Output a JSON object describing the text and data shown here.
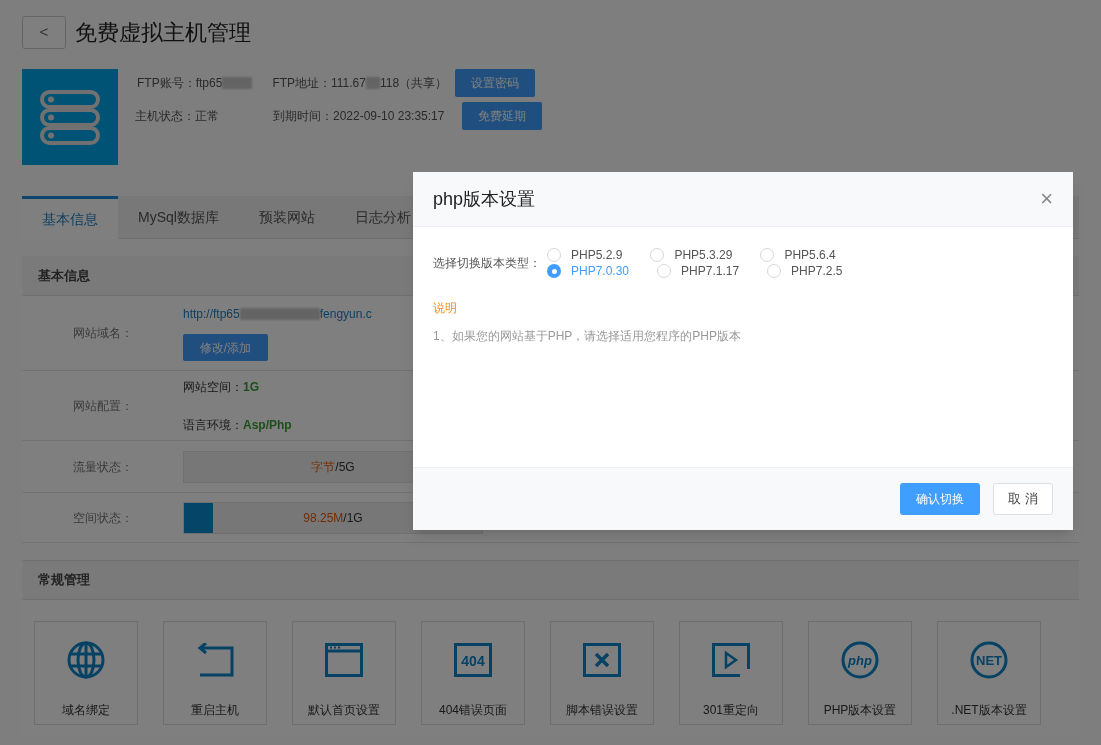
{
  "header": {
    "back": "<",
    "title": "免费虚拟主机管理"
  },
  "info": {
    "ftp_account_label": "FTP账号：",
    "ftp_account": "ftp65",
    "ftp_address_label": "FTP地址：",
    "ftp_address_start": "111.67",
    "ftp_address_end": "118（共享）",
    "set_password": "设置密码",
    "status_label": "主机状态：",
    "status": "正常",
    "expiry_label": "到期时间：",
    "expiry": "2022-09-10 23:35:17",
    "extend": "免费延期"
  },
  "tabs": [
    {
      "label": "基本信息",
      "selected": true
    },
    {
      "label": "MySql数据库",
      "selected": false
    },
    {
      "label": "预装网站",
      "selected": false
    },
    {
      "label": "日志分析",
      "selected": false
    }
  ],
  "basic": {
    "title": "基本信息",
    "domain_label": "网站域名：",
    "url_start": "http://ftp65",
    "url_end": "fengyun.c",
    "edit_button": "修改/添加",
    "config_label": "网站配置：",
    "space_label": "网站空间：",
    "space_value": "1G",
    "lang_label": "语言环境：",
    "lang_value": "Asp/Php",
    "traffic_label": "流量状态：",
    "traffic_used": "字节",
    "traffic_total": "/5G",
    "disk_label": "空间状态：",
    "disk_used": "98.25M",
    "disk_total": "/1G",
    "disk_bar": {
      "level": 0.097
    }
  },
  "management": {
    "title": "常规管理",
    "tiles": [
      {
        "kind": "globe",
        "label": "域名绑定"
      },
      {
        "kind": "return",
        "label": "重启主机"
      },
      {
        "kind": "window",
        "label": "默认首页设置"
      },
      {
        "kind": "boxtext",
        "icon_text": "404",
        "label": "404错误页面"
      },
      {
        "kind": "xbox",
        "label": "脚本错误设置"
      },
      {
        "kind": "play",
        "label": "301重定向"
      },
      {
        "kind": "circletext",
        "icon_text": "php",
        "label": "PHP版本设置"
      },
      {
        "kind": "circletext",
        "icon_text": "NET",
        "label": ".NET版本设置"
      }
    ]
  },
  "dialog": {
    "title": "php版本设置",
    "close": "×",
    "version_label": "选择切换版本类型：",
    "versions": [
      {
        "label": "PHP5.2.9",
        "selected": false
      },
      {
        "label": "PHP5.3.29",
        "selected": false
      },
      {
        "label": "PHP5.6.4",
        "selected": false
      },
      {
        "label": "PHP7.0.30",
        "selected": true
      },
      {
        "label": "PHP7.1.17",
        "selected": false
      },
      {
        "label": "PHP7.2.5",
        "selected": false
      }
    ],
    "note_title": "说明",
    "note": "1、如果您的网站基于PHP，请选择适用您程序的PHP版本",
    "confirm": "确认切换",
    "cancel": "取 消"
  }
}
